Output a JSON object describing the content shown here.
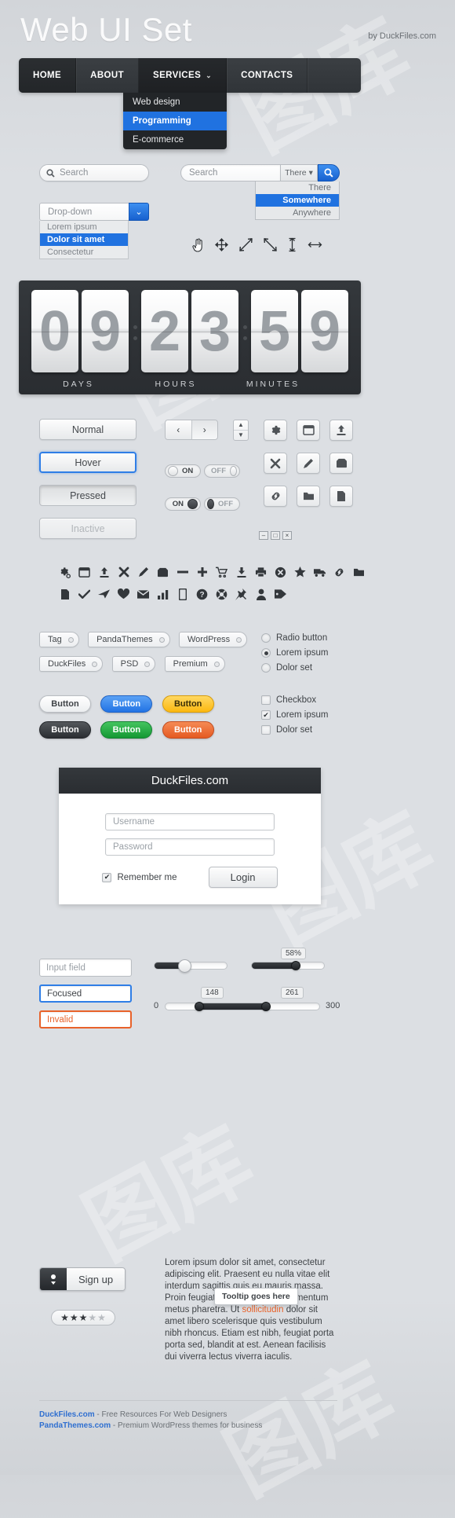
{
  "header": {
    "title": "Web UI Set",
    "byline": "by DuckFiles.com"
  },
  "nav": {
    "items": [
      "HOME",
      "ABOUT",
      "SERVICES",
      "CONTACTS"
    ],
    "caret": "⌄",
    "submenu": [
      "Web design",
      "Programming",
      "E-commerce"
    ],
    "submenu_selected": "Programming"
  },
  "search": {
    "pill_placeholder": "Search",
    "icon": "search-icon",
    "group_placeholder": "Search",
    "scope_value": "There",
    "scope_caret": "▾",
    "scope_options": [
      "There",
      "Somewhere",
      "Anywhere"
    ],
    "scope_selected": "Somewhere",
    "button_icon": "search-icon"
  },
  "dropdown": {
    "value": "Drop-down",
    "arrow": "⌄",
    "options": [
      "Lorem ipsum",
      "Dolor sit amet",
      "Consectetur"
    ],
    "selected": "Dolor sit amet"
  },
  "cursors": [
    "pointer-hand-icon",
    "move-icon",
    "resize-diagonal-icon",
    "resize-diagonal-alt-icon",
    "resize-vertical-icon",
    "resize-horizontal-icon"
  ],
  "countdown": {
    "days": "09",
    "hours": "23",
    "minutes": "59",
    "labels": [
      "DAYS",
      "HOURS",
      "MINUTES"
    ]
  },
  "state_buttons": [
    "Normal",
    "Hover",
    "Pressed",
    "Inactive"
  ],
  "pager": {
    "prev": "‹",
    "next": "›"
  },
  "spinner": {
    "up": "▲",
    "down": "▼"
  },
  "toggles": [
    {
      "label": "ON",
      "state": "on-light"
    },
    {
      "label": "OFF",
      "state": "off-light"
    },
    {
      "label": "ON",
      "state": "on-dark"
    },
    {
      "label": "OFF",
      "state": "off-dark"
    }
  ],
  "icon_buttons_rows": [
    [
      "gear-icon",
      "window-icon",
      "upload-icon"
    ],
    [
      "close-icon",
      "pencil-icon",
      "box-icon"
    ],
    [
      "link-icon",
      "folder-icon",
      "file-icon"
    ]
  ],
  "window_controls": [
    "–",
    "□",
    "×"
  ],
  "icon_grid_row1": [
    "gear-icon",
    "window-icon",
    "upload-icon",
    "close-circle-icon",
    "pencil-icon",
    "box-icon",
    "minus-icon",
    "plus-icon",
    "cart-icon",
    "download-icon",
    "print-icon",
    "star-circle-icon",
    "star-icon",
    "truck-icon"
  ],
  "icon_grid_row2": [
    "link-icon",
    "folder-icon",
    "file-icon",
    "check-icon",
    "plane-icon",
    "heart-icon",
    "mail-icon",
    "chart-icon",
    "mobile-icon",
    "help-icon",
    "lifebuoy-icon",
    "pin-icon",
    "user-icon",
    "tag-icon"
  ],
  "tags_row1": [
    "Tag",
    "PandaThemes",
    "WordPress"
  ],
  "tags_row2": [
    "DuckFiles",
    "PSD",
    "Premium"
  ],
  "radios": [
    {
      "label": "Radio button",
      "checked": false
    },
    {
      "label": "Lorem ipsum",
      "checked": true
    },
    {
      "label": "Dolor set",
      "checked": false
    }
  ],
  "checkboxes": [
    {
      "label": "Checkbox",
      "checked": false
    },
    {
      "label": "Lorem ipsum",
      "checked": true
    },
    {
      "label": "Dolor set",
      "checked": false
    }
  ],
  "color_buttons": [
    {
      "label": "Button",
      "bg": "#fbfbfc",
      "fg": "#3f4347",
      "border": "#b9bdc2"
    },
    {
      "label": "Button",
      "bg": "#3d8ff0",
      "fg": "#ffffff",
      "border": "#1f62c4"
    },
    {
      "label": "Button",
      "bg": "#fdc22e",
      "fg": "#3b2f07",
      "border": "#d79c0b"
    },
    {
      "label": "Button",
      "bg": "#3e4246",
      "fg": "#ffffff",
      "border": "#24272b"
    },
    {
      "label": "Button",
      "bg": "#25a844",
      "fg": "#ffffff",
      "border": "#168233"
    },
    {
      "label": "Button",
      "bg": "#ec6b3a",
      "fg": "#ffffff",
      "border": "#c24c1f"
    }
  ],
  "login": {
    "title": "DuckFiles.com",
    "username_placeholder": "Username",
    "password_placeholder": "Password",
    "remember_label": "Remember me",
    "remember_checked": true,
    "button_label": "Login"
  },
  "input_states": [
    {
      "label": "Input field",
      "state": "normal"
    },
    {
      "label": "Focused",
      "state": "focused"
    },
    {
      "label": "Invalid",
      "state": "invalid"
    }
  ],
  "sliders": {
    "plain": {
      "percent": 42
    },
    "labeled": {
      "percent": 58,
      "bubble": "58%"
    },
    "range": {
      "min_label": "0",
      "max_label": "300",
      "low": "148",
      "high": "261",
      "low_pct": 20,
      "high_pct": 64
    }
  },
  "signup": {
    "label": "Sign up",
    "icon": "user-download-icon"
  },
  "rating": {
    "filled": 3,
    "total": 5,
    "star": "★"
  },
  "paragraph": "Lorem ipsum dolor sit amet, consectetur adipiscing elit. Praesent eu nulla vitae elit interdum sagittis quis eu mauris massa. Proin feugiat lacinia erat et condimentum metus pharetra. Ut sollicitudin dolor sit amet libero scelerisque quis vestibulum nibh rhoncus. Etiam est nibh, feugiat porta porta sed, blandit at est. Aenean facilisis dui viverra lectus viverra iaculis.",
  "paragraph_link": "sollicitudin",
  "tooltip": "Tooltip goes here",
  "footer": [
    {
      "link": "DuckFiles.com",
      "text": " - Free Resources For Web Designers"
    },
    {
      "link": "PandaThemes.com",
      "text": " - Premium WordPress themes for business"
    }
  ],
  "watermark": "图库"
}
